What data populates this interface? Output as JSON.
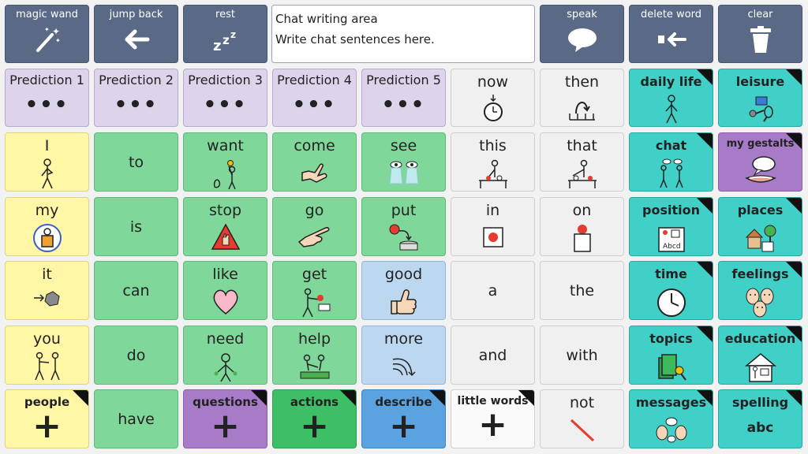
{
  "toolbar": {
    "magic_wand": "magic wand",
    "jump_back": "jump back",
    "rest": "rest",
    "speak": "speak",
    "delete_word": "delete word",
    "clear": "clear"
  },
  "chat_area": {
    "title": "Chat writing area",
    "placeholder": "Write chat sentences here."
  },
  "predictions": [
    "Prediction 1",
    "Prediction 2",
    "Prediction 3",
    "Prediction 4",
    "Prediction 5"
  ],
  "prediction_dots": "•••",
  "words": {
    "now": "now",
    "then": "then",
    "this": "this",
    "that": "that",
    "in": "in",
    "on": "on",
    "a": "a",
    "the": "the",
    "and": "and",
    "with": "with",
    "not": "not",
    "i": "I",
    "my": "my",
    "it": "it",
    "you": "you",
    "to": "to",
    "is": "is",
    "can": "can",
    "do": "do",
    "have": "have",
    "want": "want",
    "stop": "stop",
    "like": "like",
    "need": "need",
    "come": "come",
    "go": "go",
    "get": "get",
    "help": "help",
    "see": "see",
    "put": "put",
    "good": "good",
    "more": "more"
  },
  "categories": {
    "daily_life": "daily life",
    "leisure": "leisure",
    "chat": "chat",
    "my_gestalts": "my gestalts",
    "position": "position",
    "places": "places",
    "time": "time",
    "feelings": "feelings",
    "topics": "topics",
    "education": "education",
    "messages": "messages",
    "spelling": "spelling",
    "spelling_sub": "abc"
  },
  "bottom_folders": {
    "people": "people",
    "questions": "questions",
    "actions": "actions",
    "describe": "describe",
    "little_words": "little words",
    "plus": "+"
  },
  "colors": {
    "toolbar": "#5a6a86",
    "yellow": "#fff6a6",
    "green": "#7fd79a",
    "blue": "#bcd8f0",
    "teal": "#40d0c8",
    "purple": "#a77bc7",
    "lilac": "#ddd3ea"
  }
}
